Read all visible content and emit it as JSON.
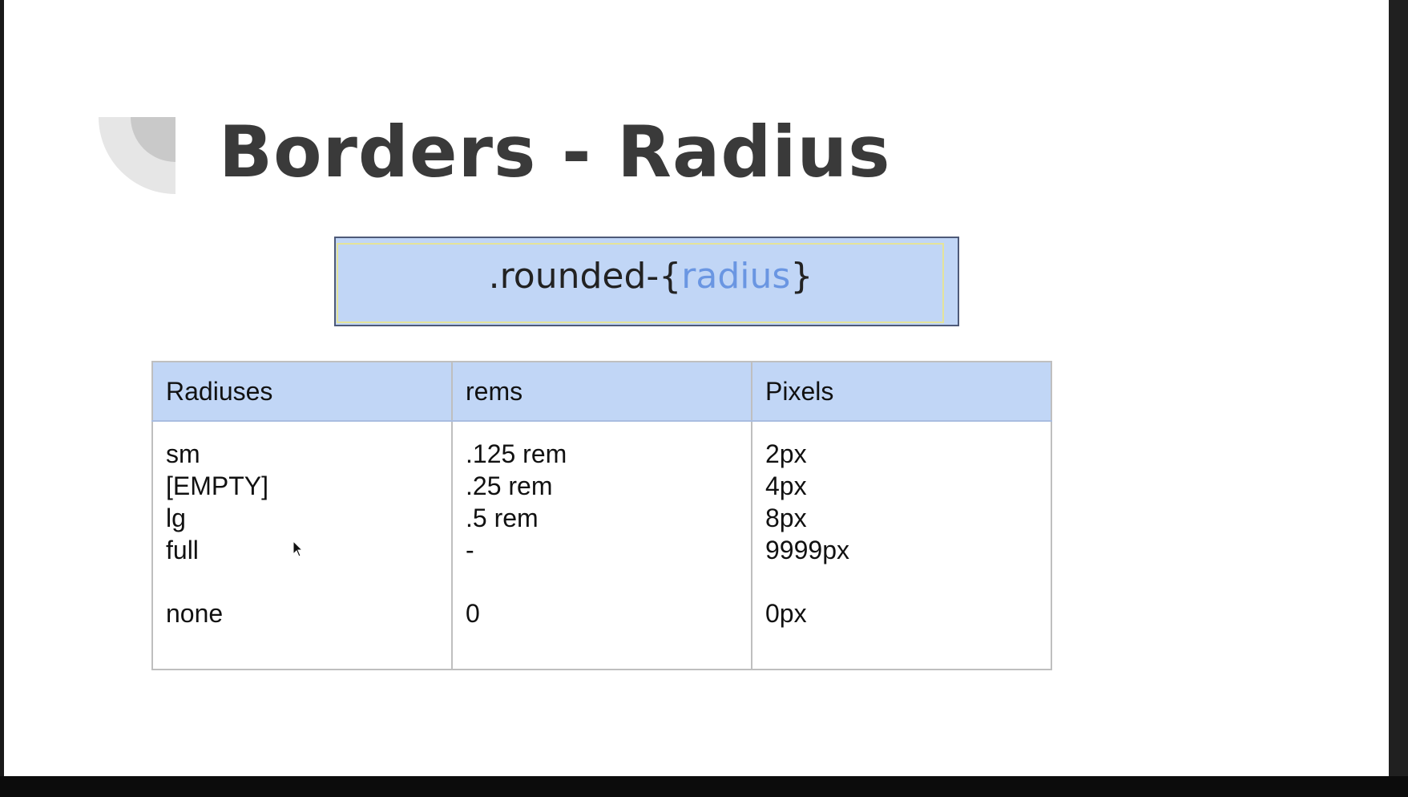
{
  "slide": {
    "title": "Borders - Radius",
    "code": {
      "prefix": ".rounded-{",
      "placeholder": "radius",
      "suffix": "}"
    }
  },
  "table": {
    "headers": [
      "Radiuses",
      "rems",
      "Pixels"
    ],
    "rows": [
      [
        "sm",
        ".125 rem",
        "2px"
      ],
      [
        "[EMPTY]",
        ".25 rem",
        "4px"
      ],
      [
        "lg",
        ".5 rem",
        "8px"
      ],
      [
        "full",
        "-",
        "9999px"
      ],
      [
        "none",
        "0",
        "0px"
      ]
    ]
  },
  "colors": {
    "header_fill": "#c1d6f6",
    "accent_text": "#6a96e2",
    "title_text": "#3a3a3a"
  },
  "icons": {
    "decoration": "quarter-circle-decoration-icon",
    "pointer": "mouse-cursor-icon"
  }
}
